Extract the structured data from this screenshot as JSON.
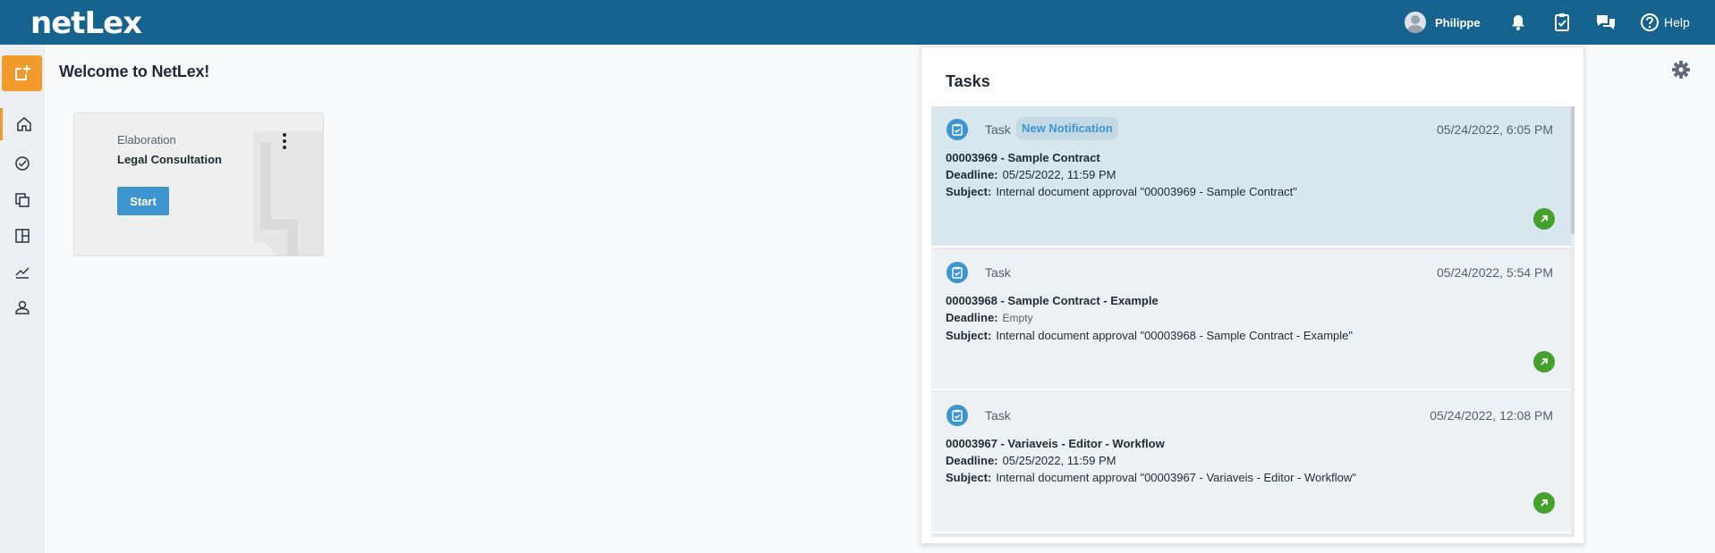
{
  "app": {
    "logo_text": "netLex",
    "colors": {
      "topbar": "#176390",
      "accent": "#f39a2c",
      "primary": "#3e95d0",
      "success": "#43a12c"
    }
  },
  "header": {
    "user_name": "Philippe",
    "icons": [
      "bell-icon",
      "clipboard-icon",
      "chat-icon",
      "help-icon"
    ],
    "help_label": "Help"
  },
  "sidebar": {
    "items": [
      "home-icon",
      "check-circle-icon",
      "documents-icon",
      "board-icon",
      "chart-icon",
      "user-icon"
    ]
  },
  "main": {
    "welcome": "Welcome to NetLex!",
    "card": {
      "category": "Elaboration",
      "title": "Legal Consultation",
      "start_label": "Start"
    }
  },
  "tasks": {
    "title": "Tasks",
    "deadline_label": "Deadline:",
    "subject_label": "Subject:",
    "items": [
      {
        "type": "Task",
        "badge": "New Notification",
        "date": "05/24/2022, 6:05 PM",
        "name": "00003969 - Sample Contract",
        "deadline": "05/25/2022, 11:59 PM",
        "subject": "Internal document approval \"00003969 - Sample Contract\""
      },
      {
        "type": "Task",
        "date": "05/24/2022, 5:54 PM",
        "name": "00003968 - Sample Contract - Example",
        "deadline": "Empty",
        "subject": "Internal document approval \"00003968 - Sample Contract - Example\""
      },
      {
        "type": "Task",
        "date": "05/24/2022, 12:08 PM",
        "name": "00003967 - Variaveis - Editor - Workflow",
        "deadline": "05/25/2022, 11:59 PM",
        "subject": "Internal document approval \"00003967 - Variaveis - Editor - Workflow\""
      }
    ]
  }
}
